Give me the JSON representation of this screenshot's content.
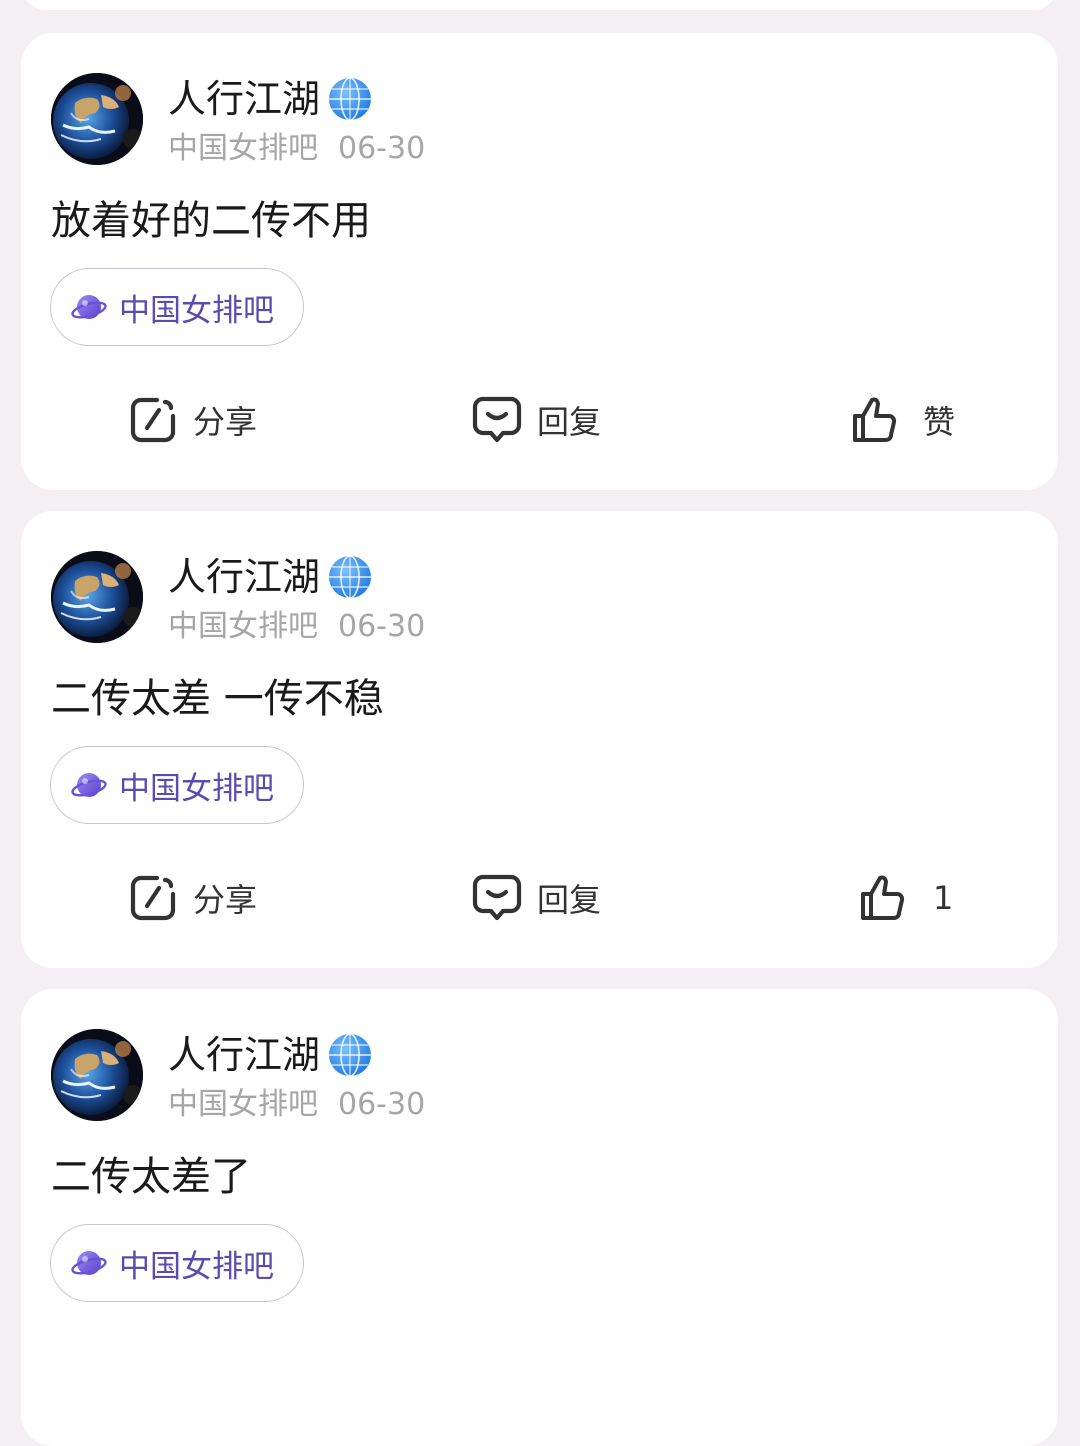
{
  "posts": [
    {
      "author": "人行江湖",
      "forum": "中国女排吧",
      "date": "06-30",
      "text": "放着好的二传不用",
      "tag": "中国女排吧",
      "actions": {
        "share": "分享",
        "reply": "回复",
        "like": "赞"
      }
    },
    {
      "author": "人行江湖",
      "forum": "中国女排吧",
      "date": "06-30",
      "text": "二传太差 一传不稳",
      "tag": "中国女排吧",
      "actions": {
        "share": "分享",
        "reply": "回复",
        "like": "1"
      }
    },
    {
      "author": "人行江湖",
      "forum": "中国女排吧",
      "date": "06-30",
      "text": "二传太差了",
      "tag": "中国女排吧"
    }
  ],
  "icons": {
    "avatar": "earth-avatar",
    "badge": "globe-icon",
    "tag": "planet-icon",
    "share": "share-icon",
    "reply": "reply-icon",
    "like": "thumbs-up-icon"
  },
  "colors": {
    "background": "#f4eff3",
    "card": "#ffffff",
    "tag_text": "#5d4ab0",
    "meta_text": "#a6a6a6",
    "globe": "#2f8cf0"
  }
}
